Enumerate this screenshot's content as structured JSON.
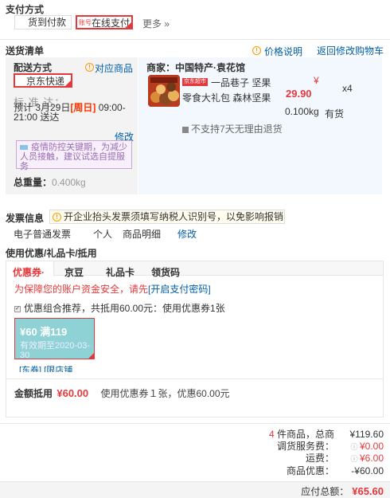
{
  "payment": {
    "title": "支付方式",
    "options": [
      "货到付款",
      "在线支付"
    ],
    "selected_prefix": "账号",
    "more": "更多 »"
  },
  "delivery": {
    "title": "送货清单",
    "price_note": "价格说明",
    "back_cart": "返回修改购物车",
    "method_label": "配送方式",
    "match_goods": "对应商品",
    "method_value": "京东快递",
    "standard_label": "标 准 达：",
    "eta_date": "预计 3月29日",
    "eta_day": "[周日]",
    "eta_time": "09:00-21:00 送达",
    "modify": "修改",
    "notice": "疫情防控关键期，为减少人员接触，建议试选自提服务",
    "weight_label": "总重量：",
    "weight_value": "0.400kg"
  },
  "merchant": {
    "label": "商家：",
    "name": "中国特产·袁花馆",
    "product_badge": "京东超市",
    "product_name": "一品巷子 坚果零食大礼包 森林坚果",
    "price_symbol": "¥",
    "price": "29.90",
    "quantity": "x4",
    "weight": "0.100kg",
    "stock": "有货",
    "no_return": "不支持7天无理由退货"
  },
  "invoice": {
    "title": "发票信息",
    "tip": "开企业抬头发票须填写纳税人识别号，以免影响报销",
    "type": "电子普通发票",
    "holder": "个人",
    "content": "商品明细",
    "modify": "修改"
  },
  "discount": {
    "title": "使用优惠/礼品卡/抵用",
    "tabs": [
      "优惠券·",
      "京豆",
      "礼品卡",
      "领货码"
    ],
    "security_text": "为保障您的账户资金安全，请先",
    "security_link": "[开启支付密码]",
    "combo_text": "优惠组合推荐，共抵用60.00元：使用优惠券1张",
    "coupon_value": "¥60 满119",
    "coupon_expire": "有效期至2020-03-30",
    "coupon_tags": "[东券]  [限店铺",
    "summary_label": "金额抵用",
    "summary_value": "¥60.00",
    "summary_detail": "使用优惠券１张，优惠60.00元"
  },
  "totals": {
    "count": "4",
    "count_text": "件商品，总商",
    "goods_total": "¥119.60",
    "service_label": "调货服务费：",
    "service_value": "¥0.00",
    "shipping_label": "运费：",
    "shipping_value": "¥6.00",
    "discount_label": "商品优惠：",
    "discount_value": "-¥60.00",
    "pay_label": "应付总额：",
    "pay_value": "¥65.60"
  },
  "colors": {
    "accent": "#e4393c",
    "link": "#005ea7",
    "panel_blue": "#f3f8ff",
    "coupon": "#8fd2d6"
  }
}
